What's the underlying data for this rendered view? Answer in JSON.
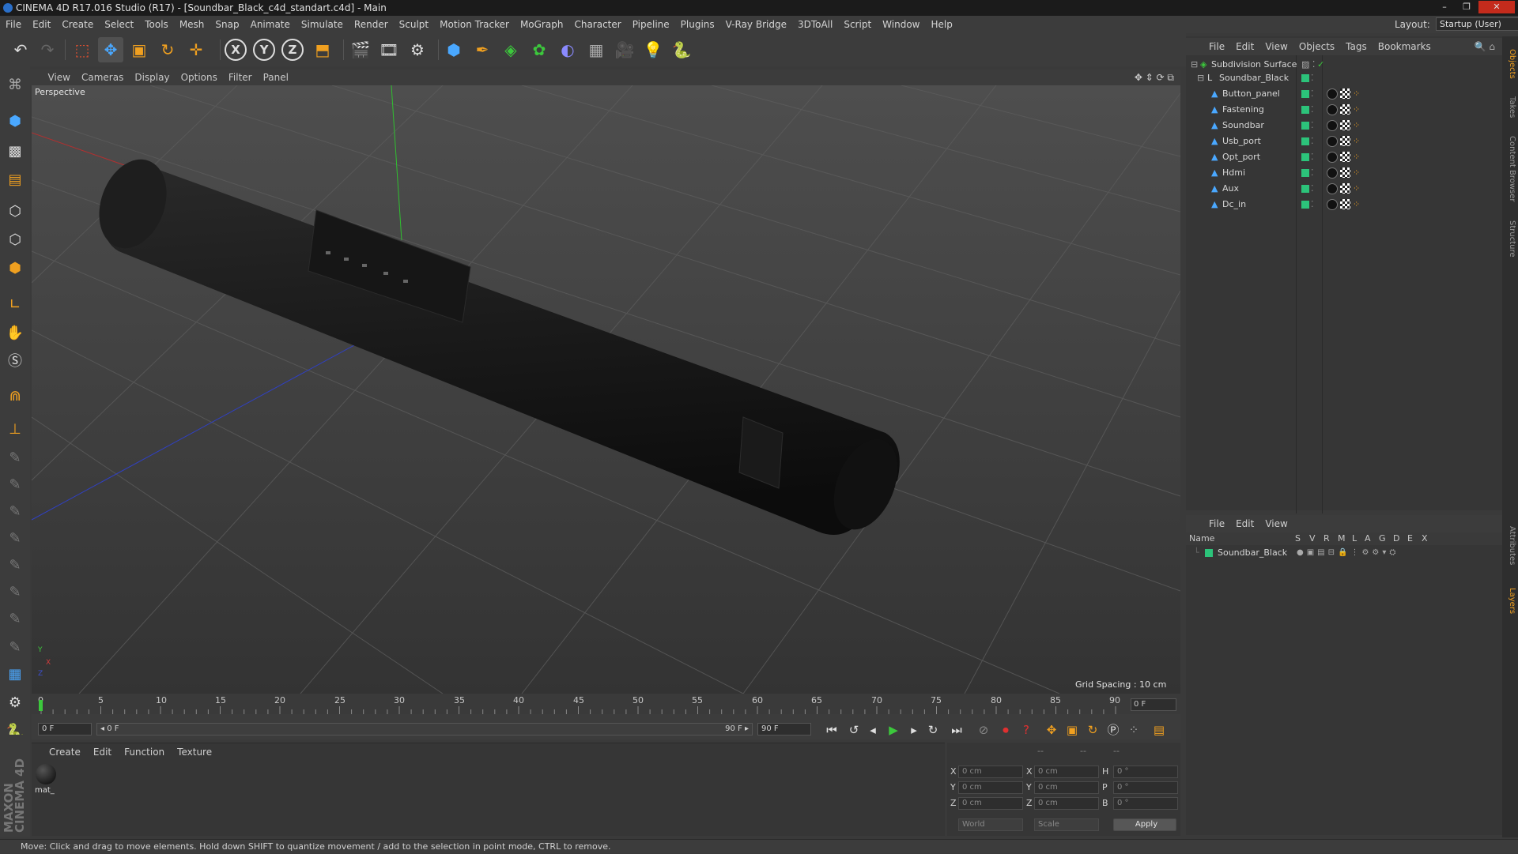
{
  "window": {
    "title": "CINEMA 4D R17.016 Studio (R17) - [Soundbar_Black_c4d_standart.c4d] - Main",
    "controls": [
      "–",
      "❐",
      "✕"
    ]
  },
  "menubar": {
    "items": [
      "File",
      "Edit",
      "Create",
      "Select",
      "Tools",
      "Mesh",
      "Snap",
      "Animate",
      "Simulate",
      "Render",
      "Sculpt",
      "Motion Tracker",
      "MoGraph",
      "Character",
      "Pipeline",
      "Plugins",
      "V-Ray Bridge",
      "3DToAll",
      "Script",
      "Window",
      "Help"
    ],
    "layout_label": "Layout:",
    "layout_value": "Startup (User)"
  },
  "toolbar": {
    "icons": [
      "undo-icon",
      "redo-icon",
      "live-selection-icon",
      "move-icon",
      "scale-icon",
      "rotate-icon",
      "recent-tool-icon",
      "x-axis-icon",
      "y-axis-icon",
      "z-axis-icon",
      "world-coord-icon",
      "render-view-icon",
      "render-picture-viewer-icon",
      "render-settings-icon",
      "cube-icon",
      "pen-spline-icon",
      "subdivision-icon",
      "cloner-icon",
      "deformer-icon",
      "floor-icon",
      "camera-icon",
      "light-icon",
      "python-icon"
    ],
    "axis_labels": [
      "X",
      "Y",
      "Z"
    ]
  },
  "viewport": {
    "menu": [
      "View",
      "Cameras",
      "Display",
      "Options",
      "Filter",
      "Panel"
    ],
    "camera_label": "Perspective",
    "grid_spacing": "Grid Spacing : 10 cm",
    "axis_labels": [
      "Y",
      "X",
      "Z"
    ]
  },
  "timeline": {
    "ticks": [
      "0",
      "5",
      "10",
      "15",
      "20",
      "25",
      "30",
      "35",
      "40",
      "45",
      "50",
      "55",
      "60",
      "65",
      "70",
      "75",
      "80",
      "85",
      "90"
    ],
    "current_frame": "0 F",
    "start_field": "0 F",
    "range_start": "◂ 0 F",
    "range_end": "90 F ▸",
    "end_field": "90 F"
  },
  "material_panel": {
    "menu": [
      "Create",
      "Edit",
      "Function",
      "Texture"
    ],
    "materials": [
      {
        "name": "mat_"
      }
    ]
  },
  "coordinates": {
    "headers": [
      "--",
      "--",
      "--"
    ],
    "rows": [
      {
        "l1": "X",
        "v1": "0 cm",
        "l2": "X",
        "v2": "0 cm",
        "l3": "H",
        "v3": "0 °"
      },
      {
        "l1": "Y",
        "v1": "0 cm",
        "l2": "Y",
        "v2": "0 cm",
        "l3": "P",
        "v3": "0 °"
      },
      {
        "l1": "Z",
        "v1": "0 cm",
        "l2": "Z",
        "v2": "0 cm",
        "l3": "B",
        "v3": "0 °"
      }
    ],
    "mode_select": "World",
    "size_select": "Scale",
    "apply": "Apply"
  },
  "object_manager": {
    "menu": [
      "File",
      "Edit",
      "View",
      "Objects",
      "Tags",
      "Bookmarks"
    ],
    "objects": [
      {
        "name": "Subdivision Surface",
        "level": 0
      },
      {
        "name": "Soundbar_Black",
        "level": 1
      },
      {
        "name": "Button_panel",
        "level": 2
      },
      {
        "name": "Fastening",
        "level": 2
      },
      {
        "name": "Soundbar",
        "level": 2
      },
      {
        "name": "Usb_port",
        "level": 2
      },
      {
        "name": "Opt_port",
        "level": 2
      },
      {
        "name": "Hdmi",
        "level": 2
      },
      {
        "name": "Aux",
        "level": 2
      },
      {
        "name": "Dc_in",
        "level": 2
      }
    ]
  },
  "layer_manager": {
    "menu": [
      "File",
      "Edit",
      "View"
    ],
    "columns": [
      "Name",
      "S",
      "V",
      "R",
      "M",
      "L",
      "A",
      "G",
      "D",
      "E",
      "X"
    ],
    "layers": [
      {
        "name": "Soundbar_Black",
        "color": "#2cc37a"
      }
    ]
  },
  "right_tabs": [
    "Objects",
    "Takes",
    "Content Browser",
    "Structure",
    "Attributes",
    "Layers"
  ],
  "status": "Move: Click and drag to move elements. Hold down SHIFT to quantize movement / add to the selection in point mode, CTRL to remove.",
  "brand": "MAXON CINEMA 4D",
  "colors": {
    "accent": "#f0a020",
    "layer_green": "#2cc37a",
    "x_axis": "#d23c3c",
    "y_axis": "#3cc83c",
    "z_axis": "#3c50d2"
  }
}
